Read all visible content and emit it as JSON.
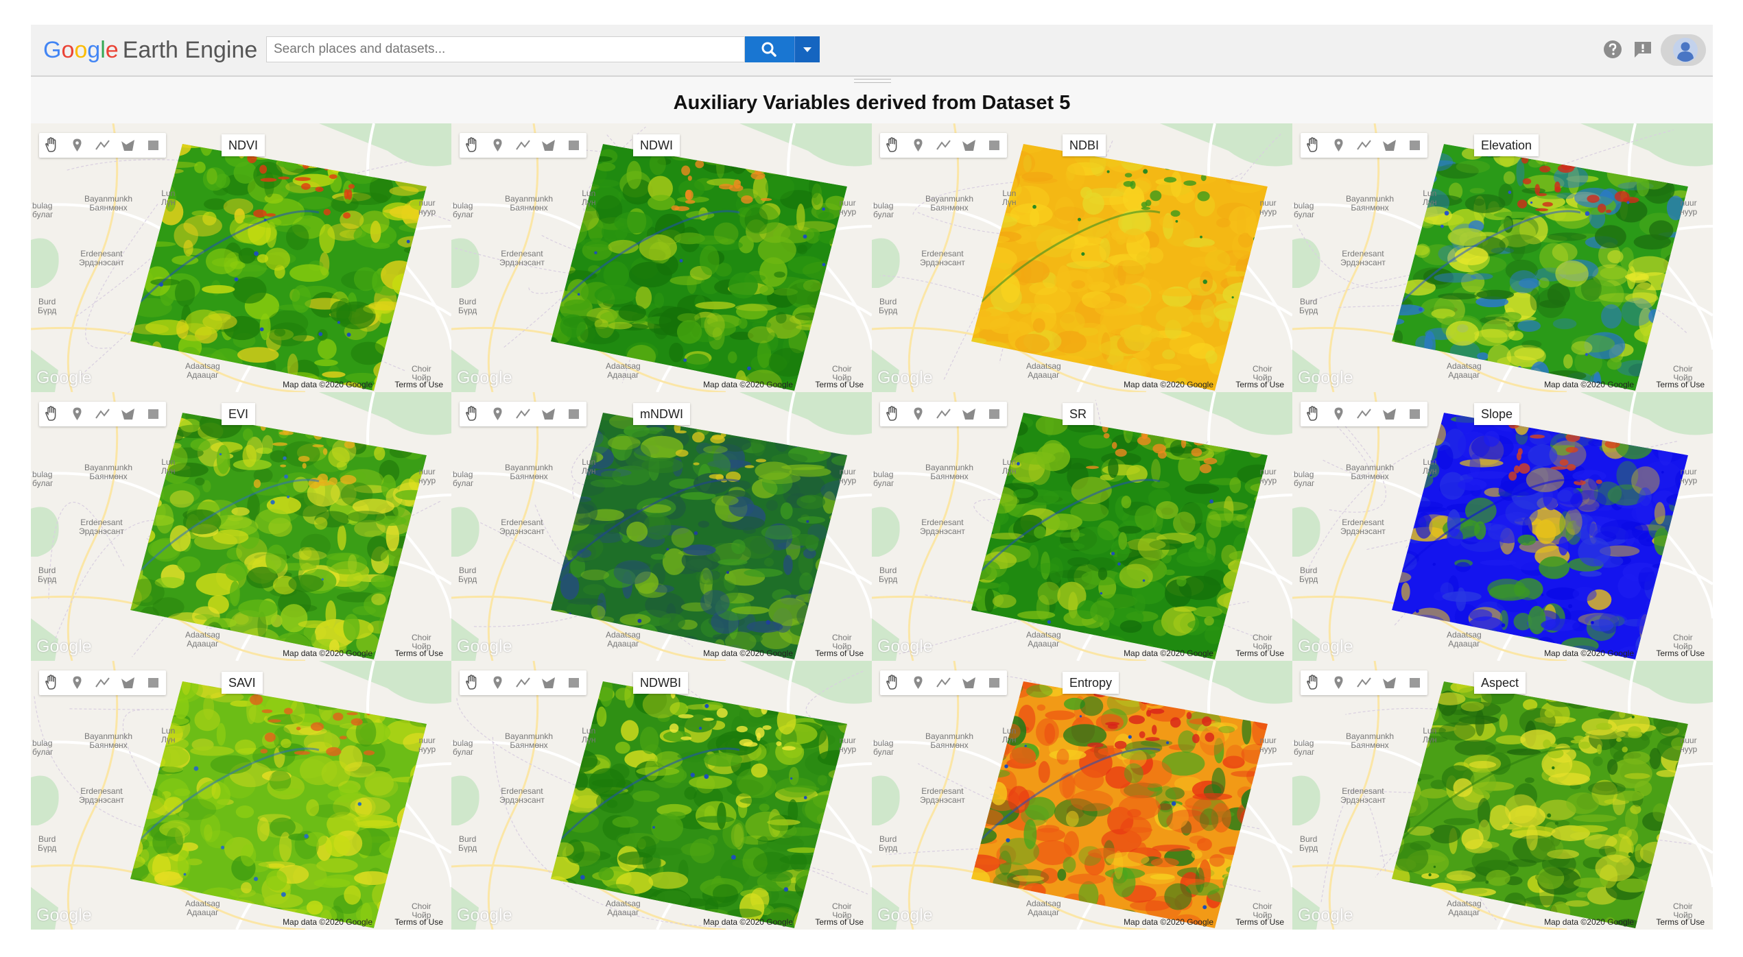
{
  "app": {
    "logo_google": [
      "G",
      "o",
      "o",
      "g",
      "l",
      "e"
    ],
    "logo_product": "Earth Engine"
  },
  "search": {
    "placeholder": "Search places and datasets..."
  },
  "title": "Auxiliary Variables derived from Dataset 5",
  "panel_common": {
    "watermark": "Google",
    "map_data": "Map data ©2020 Google",
    "terms": "Terms of Use",
    "places": {
      "bayanmunkh": [
        "Bayanmunkh",
        "Баянмөнх"
      ],
      "lun": [
        "Lun",
        "Лүн"
      ],
      "erdenesant": [
        "Erdenesant",
        "Эрдэнэсант"
      ],
      "burd": [
        "Burd",
        "Бүрд"
      ],
      "adaatsag": [
        "Adaatsag",
        "Адаацаг"
      ],
      "choir": [
        "Choir",
        "Чойр"
      ],
      "bulag": [
        "bulag",
        "булаг"
      ],
      "tuv": [
        "nuur",
        "нуур"
      ]
    }
  },
  "panels": [
    {
      "label": "NDVI",
      "palette": "ndvi"
    },
    {
      "label": "NDWI",
      "palette": "ndwi"
    },
    {
      "label": "NDBI",
      "palette": "ndbi"
    },
    {
      "label": "Elevation",
      "palette": "elev"
    },
    {
      "label": "EVI",
      "palette": "evi"
    },
    {
      "label": "mNDWI",
      "palette": "mndwi"
    },
    {
      "label": "SR",
      "palette": "sr"
    },
    {
      "label": "Slope",
      "palette": "slope"
    },
    {
      "label": "SAVI",
      "palette": "savi"
    },
    {
      "label": "NDWBI",
      "palette": "ndwbi"
    },
    {
      "label": "Entropy",
      "palette": "entropy"
    },
    {
      "label": "Aspect",
      "palette": "aspect"
    }
  ],
  "palettes": {
    "ndvi": {
      "base": "#2f9a14",
      "c": [
        "#1f7e0a",
        "#4fb012",
        "#8ccd0d",
        "#c6dc10",
        "#e8d21a"
      ],
      "hot": "#e23a12",
      "water": "#1d4fb8"
    },
    "ndwi": {
      "base": "#1f8a10",
      "c": [
        "#157208",
        "#2a9510",
        "#44a30f",
        "#6fb812",
        "#a6c918"
      ],
      "hot": "#ef8a1e",
      "water": "#1d4fb8"
    },
    "ndbi": {
      "base": "#f4b814",
      "c": [
        "#f0c81a",
        "#f9d21e",
        "#f3a712",
        "#e6d828",
        "#f6c018"
      ],
      "hot": "#3b9a1a",
      "water": "#2a8a20"
    },
    "elev": {
      "base": "#2a9a18",
      "c": [
        "#1d7010",
        "#5cb21a",
        "#b7d81f",
        "#e6e82a",
        "#2a78d0"
      ],
      "hot": "#d22a1a",
      "water": "#2955c8"
    },
    "evi": {
      "base": "#3a9e16",
      "c": [
        "#247c0c",
        "#5fb614",
        "#9bd01a",
        "#d0dc18",
        "#e8e22a"
      ],
      "hot": "#e6b01a",
      "water": "#2b6fb8"
    },
    "mndwi": {
      "base": "#1e6f28",
      "c": [
        "#1d5a3c",
        "#2a7d22",
        "#244e7a",
        "#3b9a20",
        "#7ab61a"
      ],
      "hot": "#d6c41c",
      "water": "#1f3f9a"
    },
    "sr": {
      "base": "#1f8a10",
      "c": [
        "#15700a",
        "#2c9812",
        "#4aa712",
        "#7cbd14",
        "#b3cf1a"
      ],
      "hot": "#ef8a1e",
      "water": "#1d4fb8"
    },
    "slope": {
      "base": "#1414ee",
      "c": [
        "#0a0ae6",
        "#1c1cf0",
        "#2a38e2",
        "#3b9a22",
        "#e8c21a"
      ],
      "hot": "#d8421a",
      "water": "#0a0ae6"
    },
    "savi": {
      "base": "#6cbd16",
      "c": [
        "#3f9d10",
        "#8ccd12",
        "#c8dc14",
        "#e8de22",
        "#a4d016"
      ],
      "hot": "#e2621a",
      "water": "#2b6fb8"
    },
    "ndwbi": {
      "base": "#2f9014",
      "c": [
        "#1b7a0a",
        "#4da612",
        "#93c914",
        "#d5de1e",
        "#2a8a12"
      ],
      "hot": "#f1ea3a",
      "water": "#1d4fb8"
    },
    "entropy": {
      "base": "#f29a16",
      "c": [
        "#ee5a12",
        "#f7cd1e",
        "#e83212",
        "#4ca51c",
        "#1d7a18"
      ],
      "hot": "#d8221a",
      "water": "#1d4fb8"
    },
    "aspect": {
      "base": "#4aa016",
      "c": [
        "#2a7c0e",
        "#7ab818",
        "#c6d61a",
        "#1f680c",
        "#e6e02a"
      ],
      "hot": "#a5c818",
      "water": "#2a7c0e"
    }
  }
}
